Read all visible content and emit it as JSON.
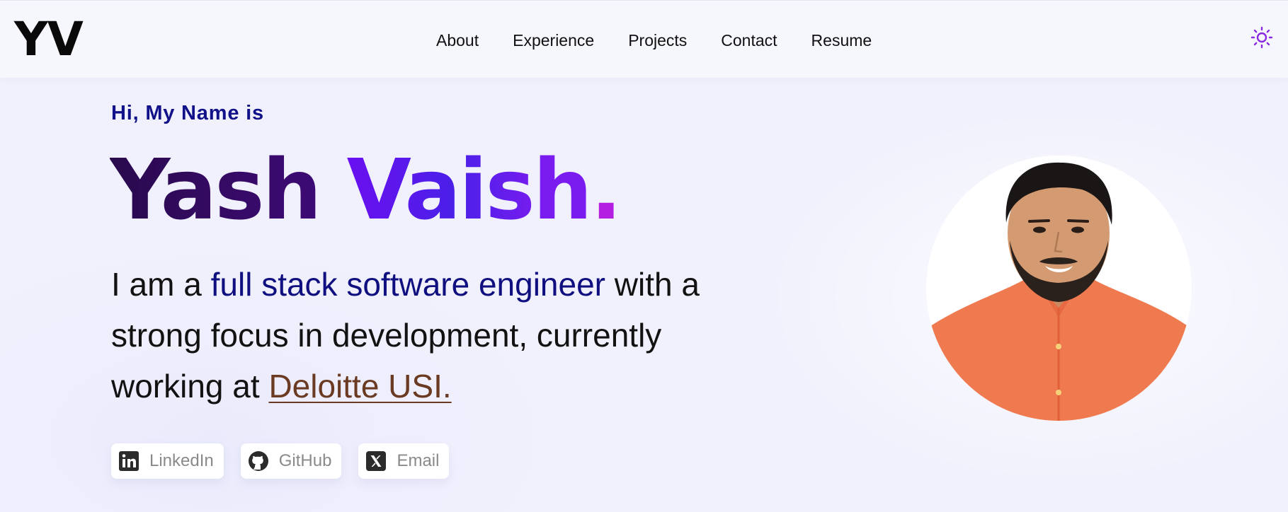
{
  "header": {
    "logo": "YV",
    "nav": [
      {
        "label": "About"
      },
      {
        "label": "Experience"
      },
      {
        "label": "Projects"
      },
      {
        "label": "Contact"
      },
      {
        "label": "Resume"
      }
    ],
    "theme_toggle_icon": "sun-icon"
  },
  "hero": {
    "greeting": "Hi, My Name is",
    "name_first": "Yash",
    "name_last": "Vaish",
    "name_dot": ".",
    "intro_prefix": "I am a ",
    "intro_highlight": "full stack software engineer",
    "intro_middle": " with a strong focus in development, currently working at ",
    "intro_company": "Deloitte USI.",
    "socials": [
      {
        "label": "LinkedIn",
        "icon": "linkedin-icon"
      },
      {
        "label": "GitHub",
        "icon": "github-icon"
      },
      {
        "label": "Email",
        "icon": "x-icon"
      }
    ]
  },
  "colors": {
    "accent": "#11118a",
    "name_gradient_start": "#6a10f0",
    "dot": "#b41ee0",
    "company_link": "#6b3a22",
    "toggle": "#8a2be2"
  }
}
